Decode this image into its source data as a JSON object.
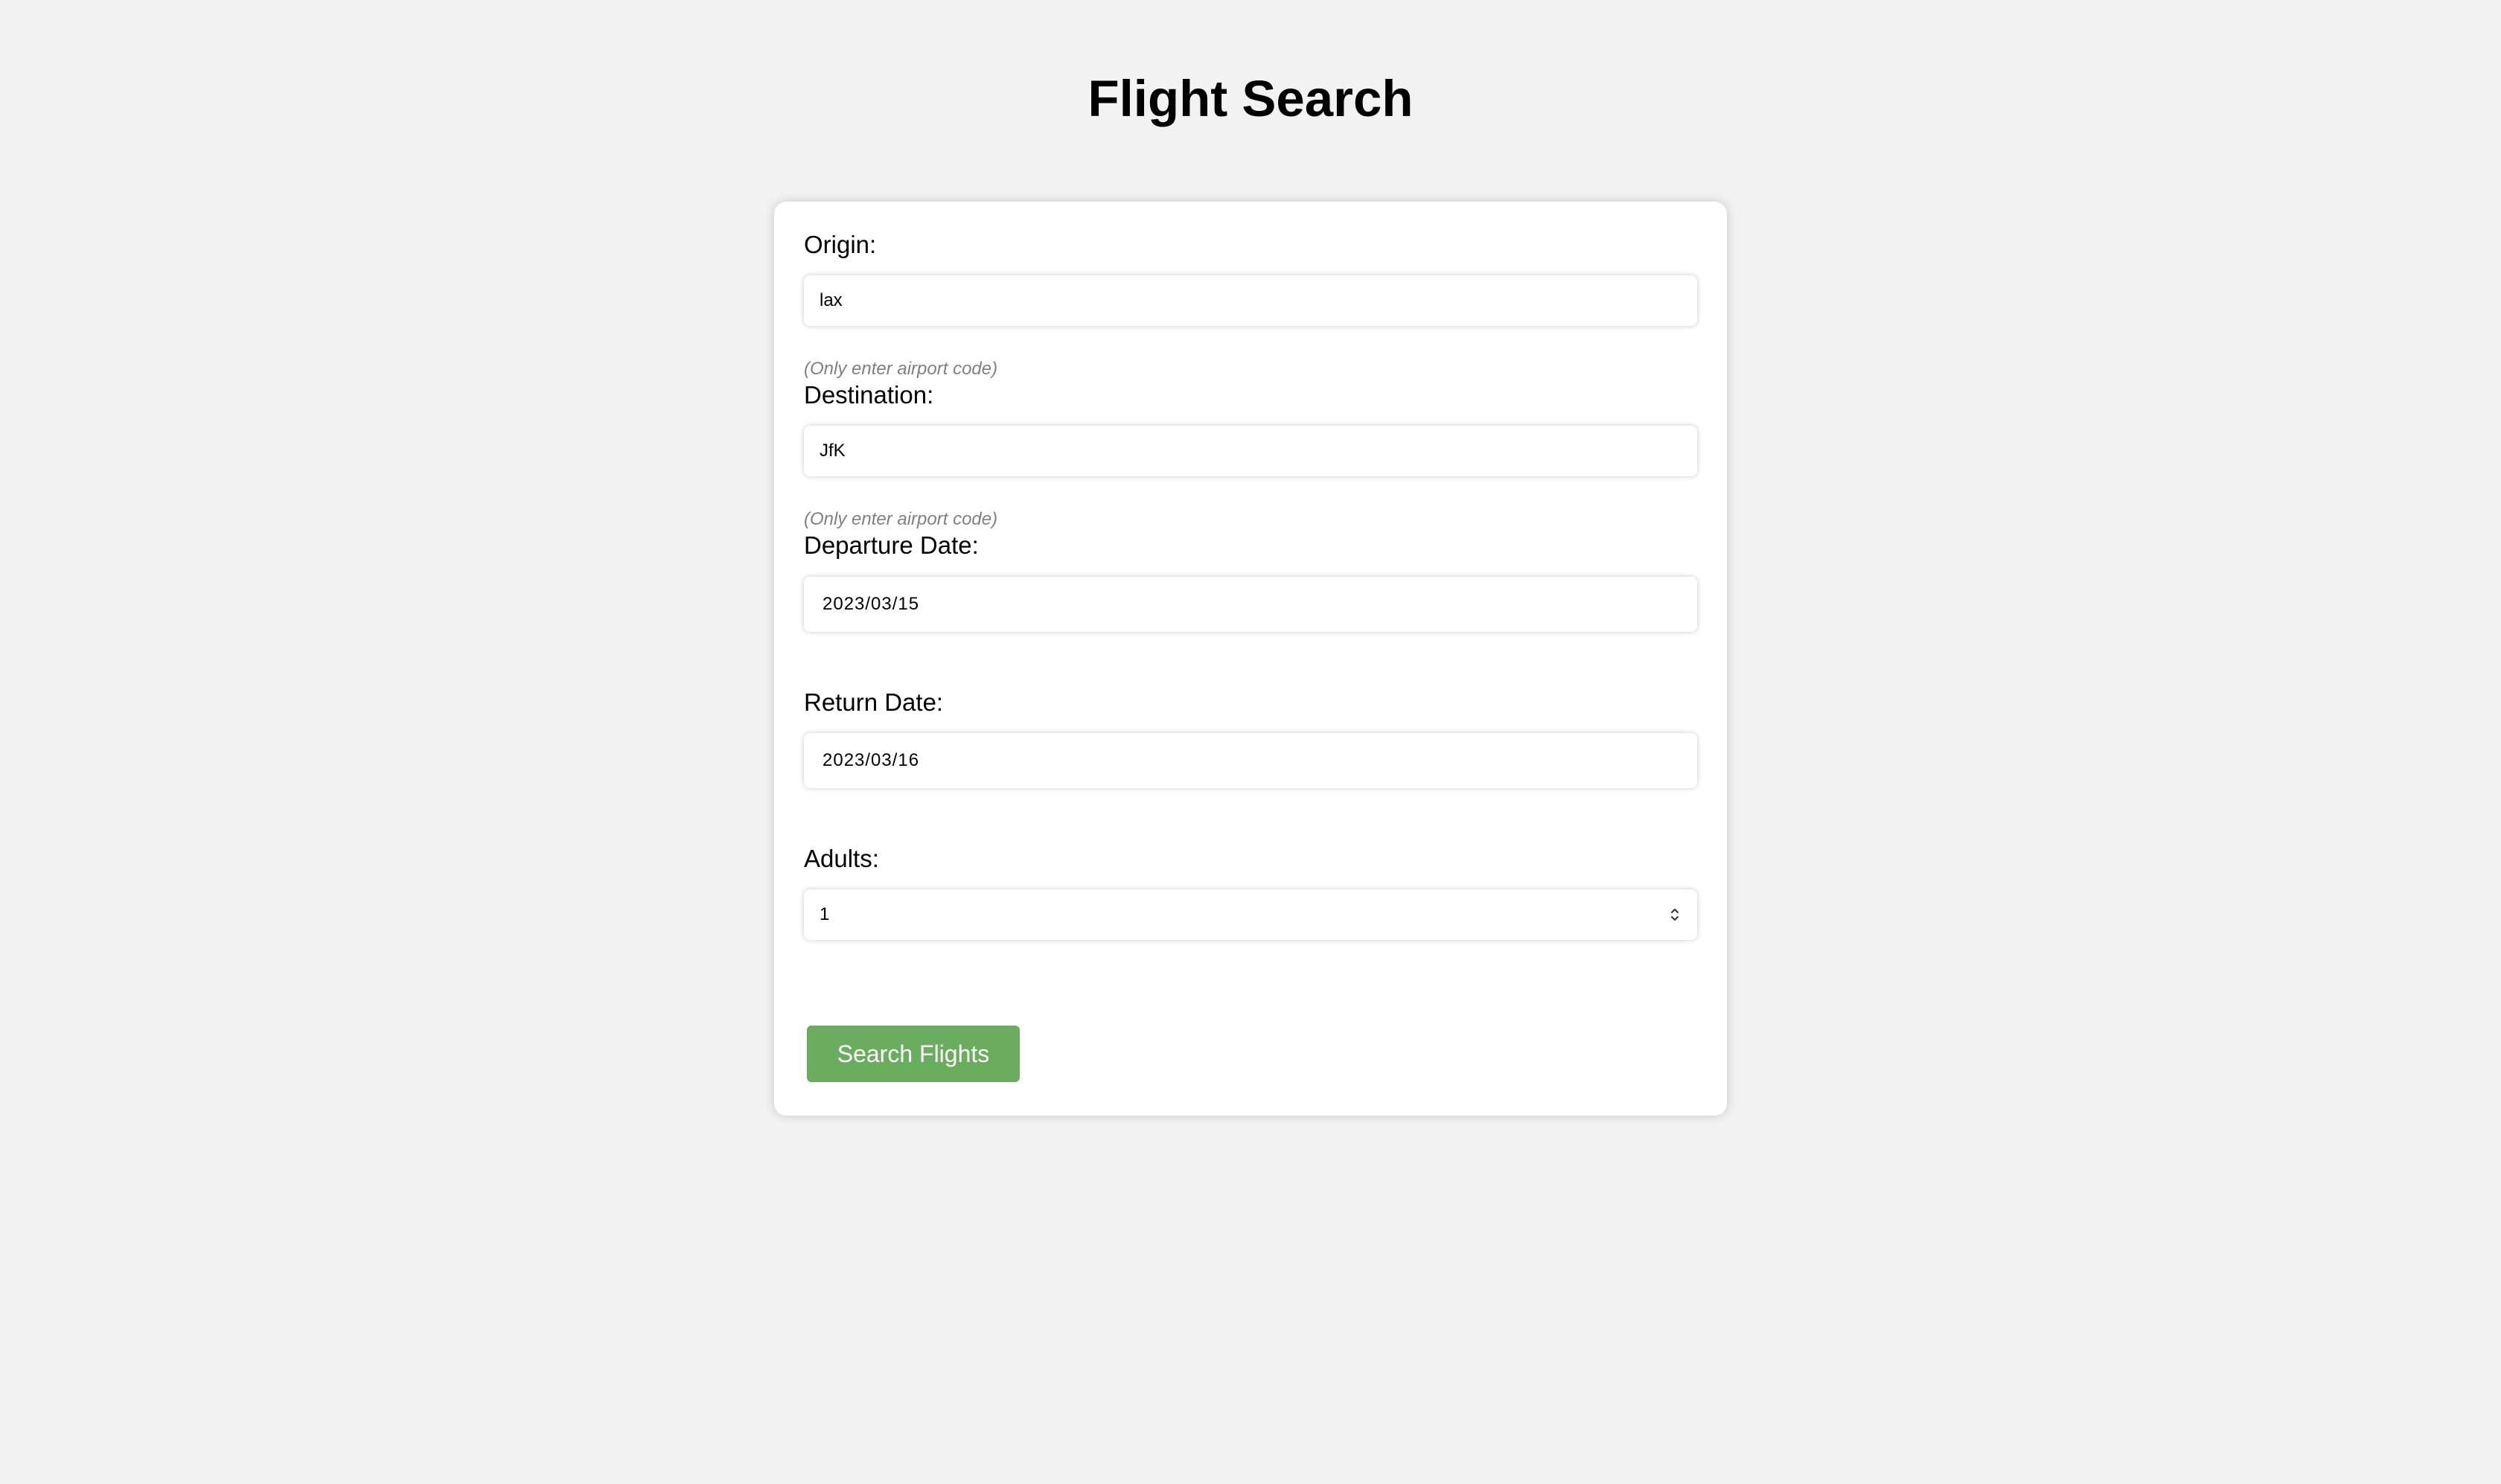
{
  "page": {
    "title": "Flight Search"
  },
  "form": {
    "origin": {
      "label": "Origin:",
      "value": "lax",
      "hint": "(Only enter airport code)"
    },
    "destination": {
      "label": "Destination:",
      "value": "JfK",
      "hint": "(Only enter airport code)"
    },
    "departure_date": {
      "label": "Departure Date:",
      "value": "2023/03/15"
    },
    "return_date": {
      "label": "Return Date:",
      "value": "2023/03/16"
    },
    "adults": {
      "label": "Adults:",
      "value": "1"
    },
    "submit_label": "Search Flights"
  },
  "colors": {
    "background": "#f2f2f2",
    "card": "#ffffff",
    "button": "#6aad5e",
    "hint": "#808080"
  },
  "icons": {
    "stepper": "up-down-chevron-icon"
  }
}
